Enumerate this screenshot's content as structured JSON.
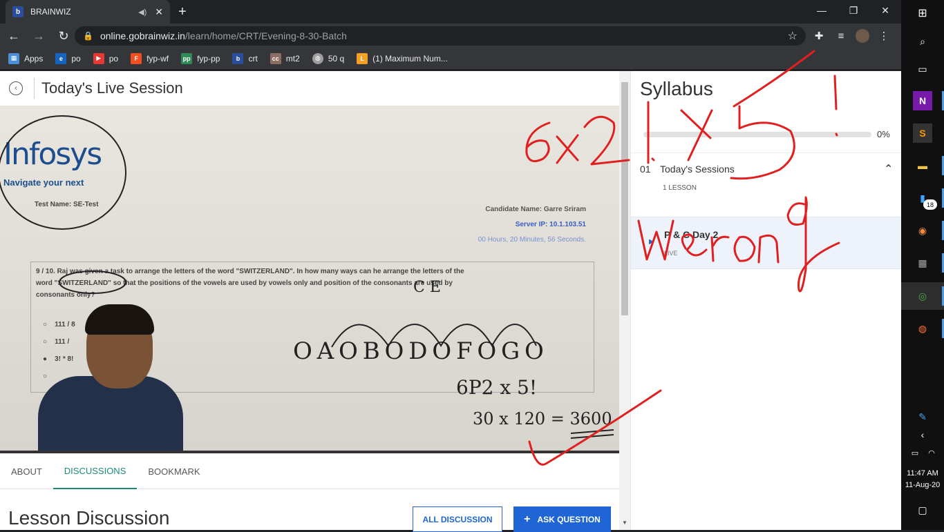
{
  "browser": {
    "tab_title": "BRAINWIZ",
    "tab_favicon": "b",
    "url_host": "online.gobrainwiz.in",
    "url_path": "/learn/home/CRT/Evening-8-30-Batch",
    "bookmarks": [
      {
        "label": "Apps",
        "color": "#4a90d9"
      },
      {
        "label": "po",
        "color": "#1565c0"
      },
      {
        "label": "po",
        "color": "#e53935"
      },
      {
        "label": "fyp-wf",
        "color": "#f24e1e"
      },
      {
        "label": "fyp-pp",
        "color": "#2e8b57"
      },
      {
        "label": "crt",
        "color": "#2a4e9e"
      },
      {
        "label": "mt2",
        "color": "#8d6e63"
      },
      {
        "label": "50 q",
        "color": "#9e9e9e"
      },
      {
        "label": "(1) Maximum Num...",
        "color": "#f4a024"
      }
    ]
  },
  "header": {
    "title": "Today's Live Session"
  },
  "video": {
    "logo_text": "Infosys",
    "logo_tagline": "Navigate your next",
    "test_name": "Test Name: SE-Test",
    "candidate": "Candidate Name: Garre Sriram",
    "server_ip": "Server IP: 10.1.103.51",
    "timer": "00 Hours, 20 Minutes, 56 Seconds.",
    "question_line1": "9 / 10.  Raj was given a task to arrange the letters of the word \"SWITZERLAND\". In how many ways can he arrange the letters of the",
    "question_line2": "word \"SWITZERLAND\" so that the positions of the vowels are used by vowels only and position of the consonants are used by",
    "question_line3": "consonants only?",
    "option1": "111 / 8",
    "option2": "111 /",
    "option3": "3! * 8!",
    "handwriting_slots": "O A O B O D O F O G O",
    "handwriting_formula": "6P2 x 5!",
    "handwriting_result": "30 x 120 = 3600"
  },
  "tabs": [
    {
      "label": "ABOUT",
      "active": false
    },
    {
      "label": "DISCUSSIONS",
      "active": true
    },
    {
      "label": "BOOKMARK",
      "active": false
    }
  ],
  "discussion": {
    "title": "Lesson Discussion",
    "all_button": "ALL DISCUSSION",
    "ask_button": "ASK QUESTION",
    "ask_icon": "+"
  },
  "syllabus": {
    "title": "Syllabus",
    "progress_label": "0%",
    "progress_value": 0,
    "section_num": "01",
    "section_title": "Today's Sessions",
    "section_count": "1 LESSON",
    "lesson_title": "P & C Day 2",
    "lesson_status": "LIVE"
  },
  "taskbar": {
    "time": "11:47 AM",
    "date": "11-Aug-20",
    "badge": "18"
  },
  "colors": {
    "accent": "#1a8b78",
    "primary_button": "#1f65d6",
    "ink": "#e02020"
  }
}
